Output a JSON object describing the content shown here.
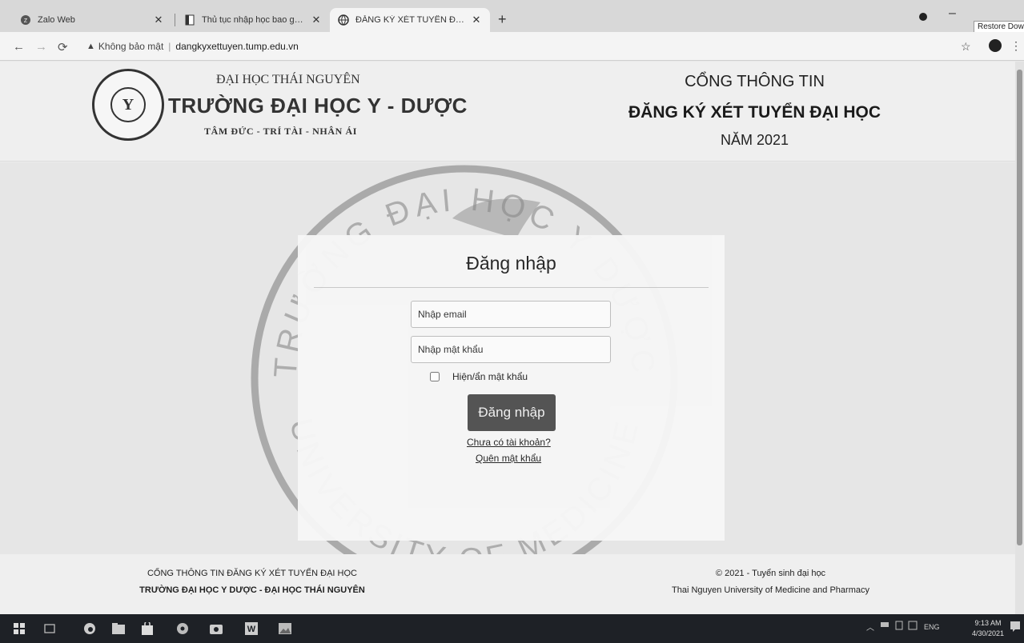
{
  "browser": {
    "tabs": [
      {
        "title": "Zalo Web",
        "icon": "zalo-icon",
        "active": false
      },
      {
        "title": "Thủ tục nhập học bao gồm nhữn",
        "icon": "document-icon",
        "active": false
      },
      {
        "title": "ĐĂNG KÝ XÉT TUYỂN ĐẠI HỌC",
        "icon": "globe-icon",
        "active": true
      }
    ],
    "new_tab": "+",
    "tooltip": "Restore Down",
    "security_label": "Không bảo mật",
    "url_divider": "|",
    "url": "dangkyxettuyen.tump.edu.vn"
  },
  "header": {
    "parent_university": "ĐẠI HỌC THÁI NGUYÊN",
    "university_name": "TRƯỜNG ĐẠI HỌC Y - DƯỢC",
    "motto": "TÂM ĐỨC - TRÍ TÀI - NHÂN ÁI",
    "logo_letter": "Y",
    "portal_line1": "CỔNG THÔNG TIN",
    "portal_line2": "ĐĂNG KÝ XÉT TUYỂN ĐẠI HỌC",
    "portal_line3": "NĂM 2021"
  },
  "watermark": {
    "top_text": "TRƯỜNG ĐẠI HỌC Y DƯỢC",
    "bottom_text": "UNIVERSITY OF MEDICINE"
  },
  "login": {
    "title": "Đăng nhập",
    "email_placeholder": "Nhập email",
    "password_placeholder": "Nhập mật khẩu",
    "show_password_label": "Hiện/ẩn mật khẩu",
    "submit_label": "Đăng nhập",
    "register_link": "Chưa có tài khoản?",
    "forgot_link": "Quên mật khẩu"
  },
  "footer": {
    "left_line1": "CỔNG THÔNG TIN ĐĂNG KÝ XÉT TUYỂN ĐẠI HỌC",
    "left_line2": "TRƯỜNG ĐẠI HỌC Y DƯỢC - ĐẠI HỌC THÁI NGUYÊN",
    "right_line1": "© 2021 - Tuyển sinh đại học",
    "right_line2": "Thai Nguyen University of Medicine and Pharmacy"
  },
  "taskbar": {
    "language": "ENG",
    "time": "9:13 AM",
    "date": "4/30/2021"
  }
}
